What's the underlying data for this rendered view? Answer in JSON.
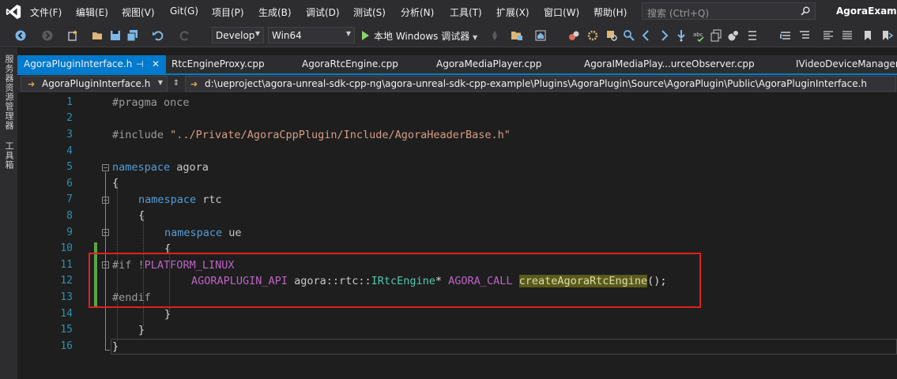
{
  "menubar": {
    "items": [
      "文件(F)",
      "编辑(E)",
      "视图(V)",
      "Git(G)",
      "项目(P)",
      "生成(B)",
      "调试(D)",
      "测试(S)",
      "分析(N)",
      "工具(T)",
      "扩展(X)",
      "窗口(W)",
      "帮助(H)"
    ],
    "search_placeholder": "搜索 (Ctrl+Q)",
    "solution_title": "AgoraExamp"
  },
  "toolbar": {
    "config": "Develop",
    "platform": "Win64",
    "run_label": "本地 Windows 调试器"
  },
  "sidepanel": {
    "server_explorer": "服务器资源管理器",
    "toolbox": "工具箱"
  },
  "tabs": {
    "active": "AgoraPluginInterface.h",
    "others": [
      "RtcEngineProxy.cpp",
      "AgoraRtcEngine.cpp",
      "AgoraMediaPlayer.cpp",
      "AgoraIMediaPlay...urceObserver.cpp",
      "IVideoDeviceManager"
    ]
  },
  "navbar": {
    "file": "AgoraPluginInterface.h",
    "path": "d:\\ueproject\\agora-unreal-sdk-cpp-ng\\agora-unreal-sdk-cpp-example\\Plugins\\AgoraPlugin\\Source\\AgoraPlugin\\Public\\AgoraPluginInterface.h"
  },
  "editor": {
    "line_numbers": [
      "1",
      "2",
      "3",
      "4",
      "5",
      "6",
      "7",
      "8",
      "9",
      "10",
      "11",
      "12",
      "13",
      "14",
      "15",
      "16"
    ],
    "code": {
      "l1": "#pragma once",
      "l3_pre": "#include ",
      "l3_str": "\"../Private/AgoraCppPlugin/Include/AgoraHeaderBase.h\"",
      "kw_namespace": "namespace",
      "l5_name": "agora",
      "brace_open": "{",
      "brace_close": "}",
      "l7_name": "rtc",
      "l9_name": "ue",
      "l11_if": "#if",
      "l11_not": "!",
      "l11_macro": "PLATFORM_LINUX",
      "l12_api": "AGORAPLUGIN_API",
      "l12_ns": "agora::rtc::",
      "l12_type": "IRtcEngine",
      "l12_star": "*",
      "l12_call": "AGORA_CALL",
      "l12_func": "createAgoraRtcEngine",
      "l12_tail": "();",
      "l13": "#endif"
    }
  }
}
